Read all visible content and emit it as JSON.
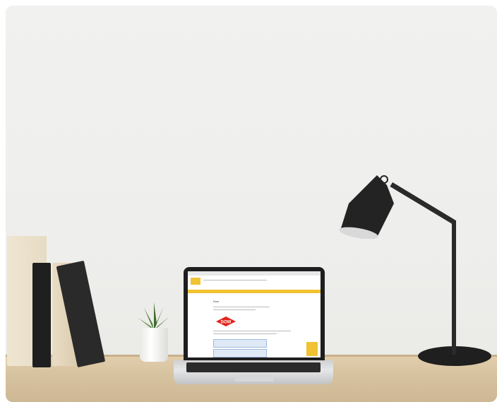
{
  "scene": {
    "description_colors": {
      "wall": "#efefed",
      "desk": "#d9c4a1",
      "lamp": "#222222",
      "screen_accent": "#f1c232",
      "logo_red": "#e2231a"
    },
    "screen": {
      "page_heading": "Dow",
      "logo_text": "DOW"
    }
  }
}
